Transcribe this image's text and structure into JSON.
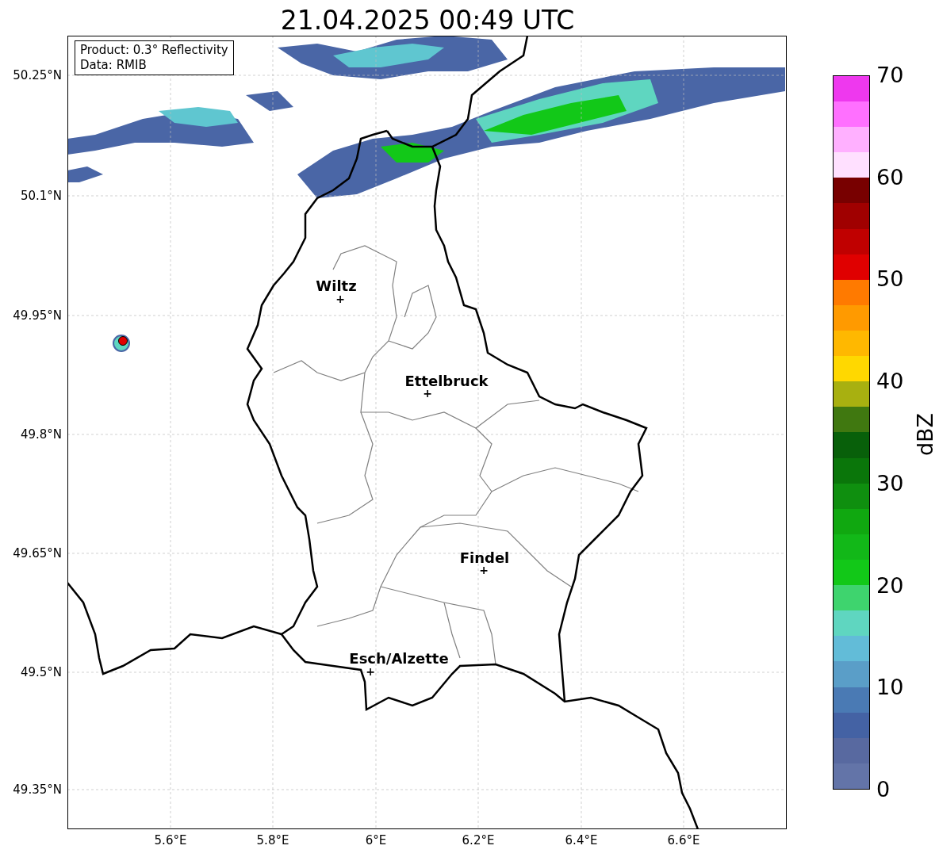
{
  "title": "21.04.2025 00:49 UTC",
  "info_box": [
    "Product: 0.3° Reflectivity",
    "Data: RMIB"
  ],
  "y_ticks": [
    "50.25°N",
    "50.1°N",
    "49.95°N",
    "49.8°N",
    "49.65°N",
    "49.5°N",
    "49.35°N"
  ],
  "x_ticks": [
    "5.6°E",
    "5.8°E",
    "6°E",
    "6.2°E",
    "6.4°E",
    "6.6°E"
  ],
  "cities": [
    {
      "name": "Wiltz",
      "marker": "+"
    },
    {
      "name": "Ettelbruck",
      "marker": "+"
    },
    {
      "name": "Findel",
      "marker": "+"
    },
    {
      "name": "Esch/Alzette",
      "marker": "+"
    }
  ],
  "colorbar": {
    "label": "dBZ",
    "ticks": [
      "70",
      "60",
      "50",
      "40",
      "30",
      "20",
      "10",
      "0"
    ],
    "bins": [
      {
        "color": "#6374a8"
      },
      {
        "color": "#5869a0"
      },
      {
        "color": "#4462a4"
      },
      {
        "color": "#4a7ab4"
      },
      {
        "color": "#5a9ec8"
      },
      {
        "color": "#62bcd8"
      },
      {
        "color": "#5fd6c0"
      },
      {
        "color": "#3ed46e"
      },
      {
        "color": "#12c818"
      },
      {
        "color": "#12b818"
      },
      {
        "color": "#10a810"
      },
      {
        "color": "#0f8f0f"
      },
      {
        "color": "#0a760a"
      },
      {
        "color": "#08600a"
      },
      {
        "color": "#407810"
      },
      {
        "color": "#a8b010"
      },
      {
        "color": "#ffd800"
      },
      {
        "color": "#ffb800"
      },
      {
        "color": "#ff9a00"
      },
      {
        "color": "#ff7a00"
      },
      {
        "color": "#e00000"
      },
      {
        "color": "#c00000"
      },
      {
        "color": "#a00000"
      },
      {
        "color": "#780000"
      },
      {
        "color": "#ffe0ff"
      },
      {
        "color": "#ffb0ff"
      },
      {
        "color": "#ff70ff"
      },
      {
        "color": "#ee38ee"
      }
    ]
  }
}
